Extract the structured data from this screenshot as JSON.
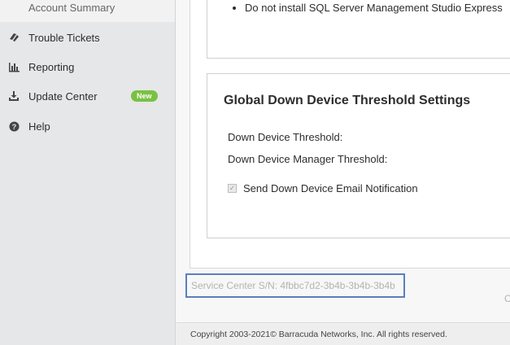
{
  "sidebar": {
    "sub_item": "Account Summary",
    "items": [
      {
        "label": "Trouble Tickets",
        "icon": "ticket-icon"
      },
      {
        "label": "Reporting",
        "icon": "bar-chart-icon"
      },
      {
        "label": "Update Center",
        "icon": "download-icon",
        "badge": "New"
      },
      {
        "label": "Help",
        "icon": "help-icon"
      }
    ],
    "badge_color": "#7ac143"
  },
  "top_card": {
    "bullet": "Do not install SQL Server Management Studio Express"
  },
  "threshold_card": {
    "title": "Global Down Device Threshold Settings",
    "down_device_threshold_label": "Down Device Threshold:",
    "manager_threshold_label": "Down Device Manager Threshold:",
    "email_notification_label": "Send Down Device Email Notification",
    "email_notification_checked": true
  },
  "service_center": {
    "serial_text": "Service Center S/N: 4fbbc7d2-3b4b-3b4b-3b4b",
    "highlight_color": "#5b7fc0"
  },
  "right_edge_glyph": "C",
  "footer": {
    "copyright": "Copyright 2003-2021© Barracuda Networks, Inc. All rights reserved."
  }
}
